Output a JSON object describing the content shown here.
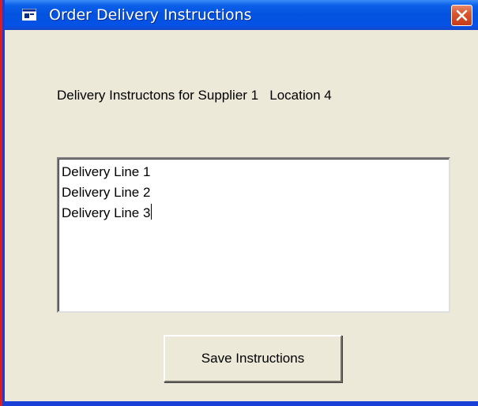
{
  "window": {
    "title": "Order Delivery Instructions",
    "icon": "window-app-icon",
    "close_icon": "close-icon"
  },
  "form": {
    "label": "Delivery Instructons for Supplier 1   Location 4",
    "instructions_lines": [
      "Delivery Line 1",
      "Delivery Line 2",
      "Delivery Line 3"
    ],
    "save_button_label": "Save Instructions"
  },
  "colors": {
    "titlebar": "#0453e0",
    "window_border": "#1a3fd6",
    "background": "#ece9d8",
    "close_button": "#d9562f"
  }
}
